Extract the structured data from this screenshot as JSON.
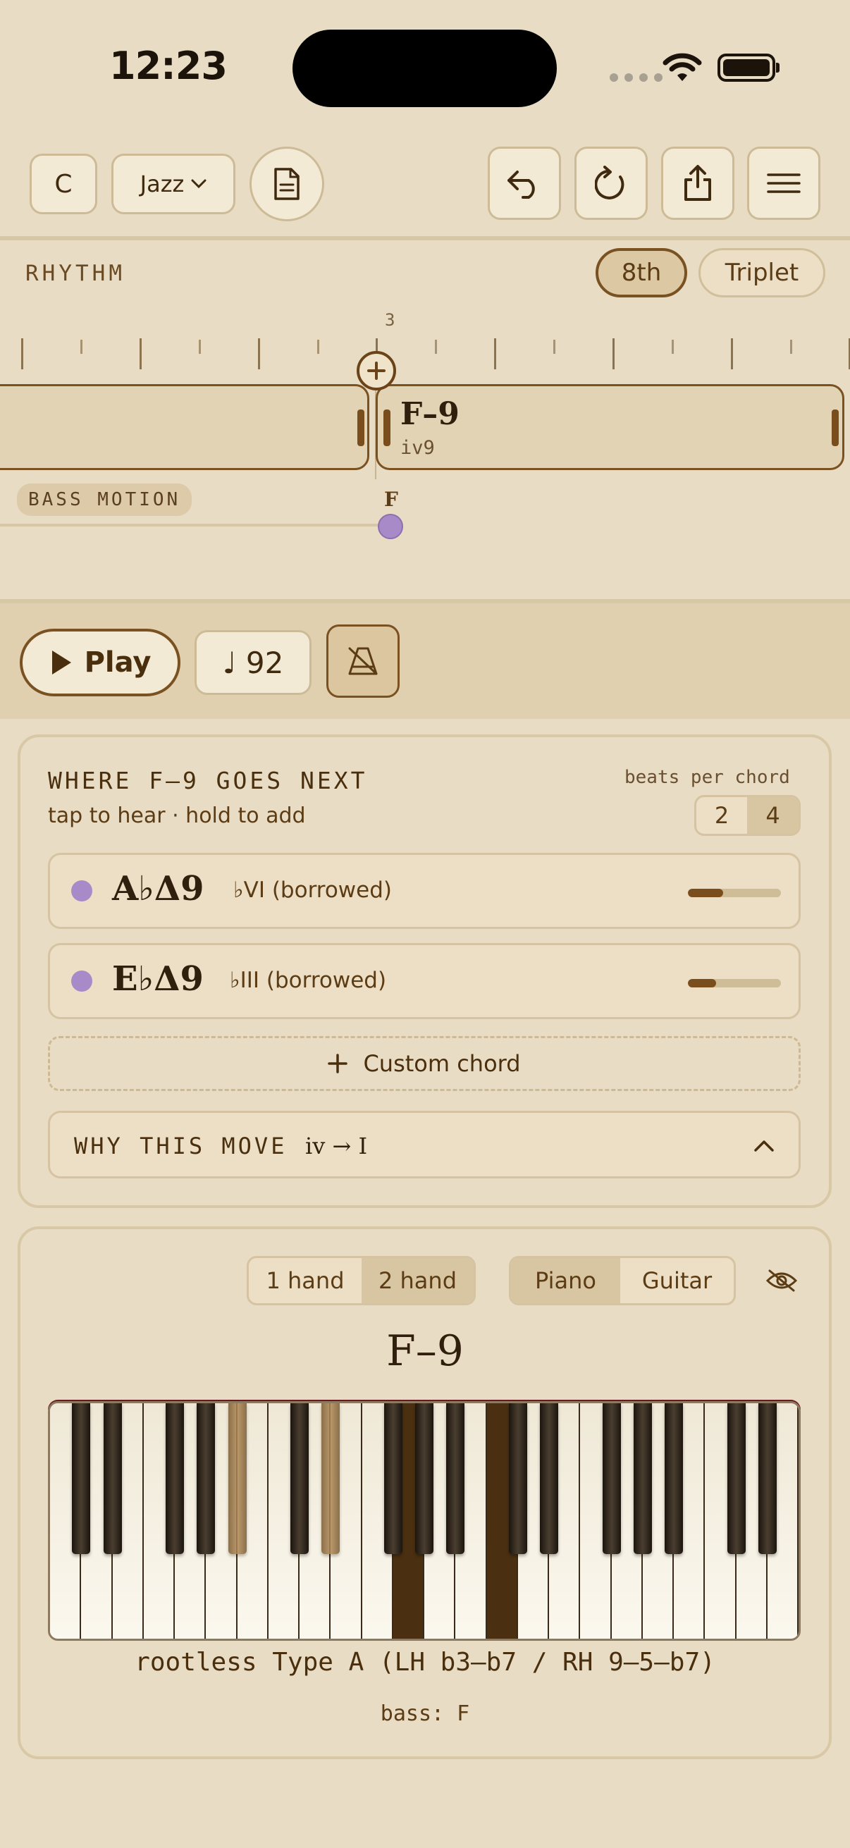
{
  "status": {
    "time": "12:23"
  },
  "toolbar": {
    "key": "C",
    "style": "Jazz"
  },
  "rhythm": {
    "label": "RHYTHM",
    "opt_8th": "8th",
    "opt_triplet": "Triplet",
    "ruler_num": "3"
  },
  "timeline": {
    "chord_name": "F–9",
    "chord_roman": "iv9",
    "bass_motion_label": "BASS MOTION",
    "bass_note": "F"
  },
  "transport": {
    "play_label": "Play",
    "tempo": "♩ 92"
  },
  "next": {
    "title": "WHERE F–9 GOES NEXT",
    "subtitle": "tap to hear · hold to add",
    "beats_label": "beats per chord",
    "beats_options": [
      "2",
      "4"
    ],
    "beats_selected": "4",
    "suggestions": [
      {
        "chord": "A♭Δ9",
        "function": "♭VI (borrowed)",
        "strength": 0.38
      },
      {
        "chord": "E♭Δ9",
        "function": "♭III (borrowed)",
        "strength": 0.3
      }
    ],
    "custom_label": "Custom chord",
    "why_label": "WHY THIS MOVE",
    "why_formula": "iv → I"
  },
  "voicing": {
    "hand_options": [
      "1 hand",
      "2 hand"
    ],
    "hand_selected": "2 hand",
    "instrument_options": [
      "Piano",
      "Guitar"
    ],
    "instrument_selected": "Piano",
    "chord_name": "F–9",
    "description": "rootless Type A (LH b3–b7 / RH 9–5–b7)",
    "bass": "bass: F"
  },
  "colors": {
    "background": "#e8dcc4",
    "accent": "#7a4e1c",
    "dot": "#a98ac8"
  }
}
